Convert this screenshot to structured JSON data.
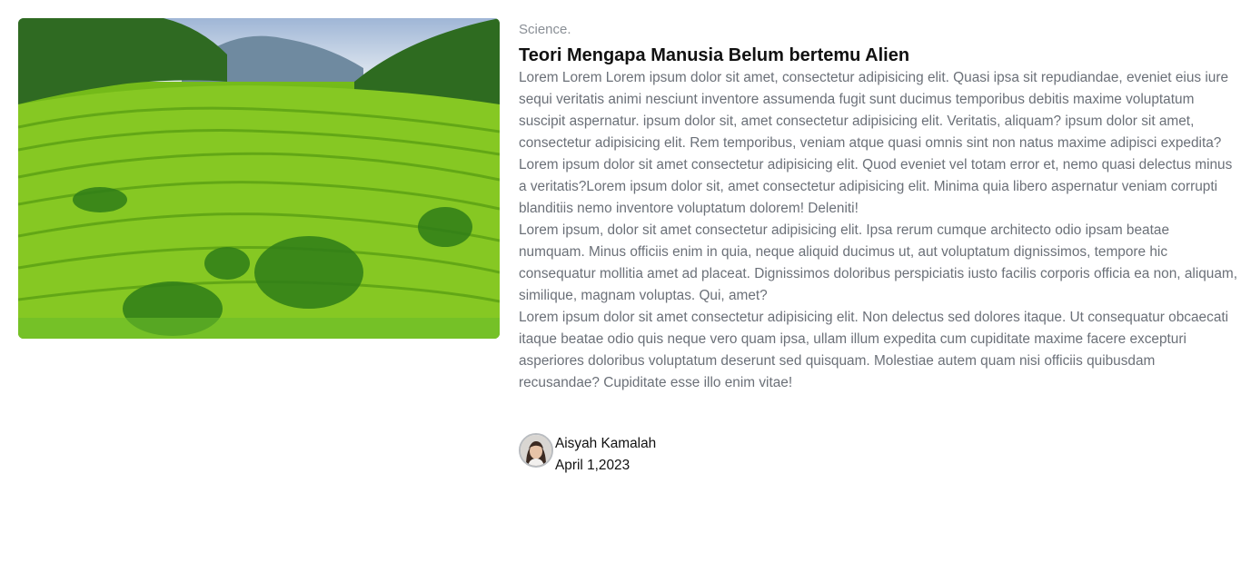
{
  "article": {
    "category": "Science.",
    "title": "Teori Mengapa Manusia Belum bertemu Alien",
    "paragraphs": [
      "Lorem Lorem Lorem ipsum dolor sit amet, consectetur adipisicing elit. Quasi ipsa sit repudiandae, eveniet eius iure sequi veritatis animi nesciunt inventore assumenda fugit sunt ducimus temporibus debitis maxime voluptatum suscipit aspernatur. ipsum dolor sit, amet consectetur adipisicing elit. Veritatis, aliquam? ipsum dolor sit amet, consectetur adipisicing elit. Rem temporibus, veniam atque quasi omnis sint non natus maxime adipisci expedita?",
      "Lorem ipsum dolor sit amet consectetur adipisicing elit. Quod eveniet vel totam error et, nemo quasi delectus minus a veritatis?Lorem ipsum dolor sit, amet consectetur adipisicing elit. Minima quia libero aspernatur veniam corrupti blanditiis nemo inventore voluptatum dolorem! Deleniti!",
      "Lorem ipsum, dolor sit amet consectetur adipisicing elit. Ipsa rerum cumque architecto odio ipsam beatae numquam. Minus officiis enim in quia, neque aliquid ducimus ut, aut voluptatum dignissimos, tempore hic consequatur mollitia amet ad placeat. Dignissimos doloribus perspiciatis iusto facilis corporis officia ea non, aliquam, similique, magnam voluptas. Qui, amet?",
      "Lorem ipsum dolor sit amet consectetur adipisicing elit. Non delectus sed dolores itaque. Ut consequatur obcaecati itaque beatae odio quis neque vero quam ipsa, ullam illum expedita cum cupiditate maxime facere excepturi asperiores doloribus voluptatum deserunt sed quisquam. Molestiae autem quam nisi officiis quibusdam recusandae? Cupiditate esse illo enim vitae!"
    ],
    "author": {
      "name": "Aisyah Kamalah",
      "date": "April 1,2023"
    }
  },
  "colors": {
    "title": "#111111",
    "body_text": "#6b7078",
    "category": "#8a8f96"
  },
  "icons": {
    "hero": "rice-terrace-image",
    "avatar": "author-avatar"
  }
}
